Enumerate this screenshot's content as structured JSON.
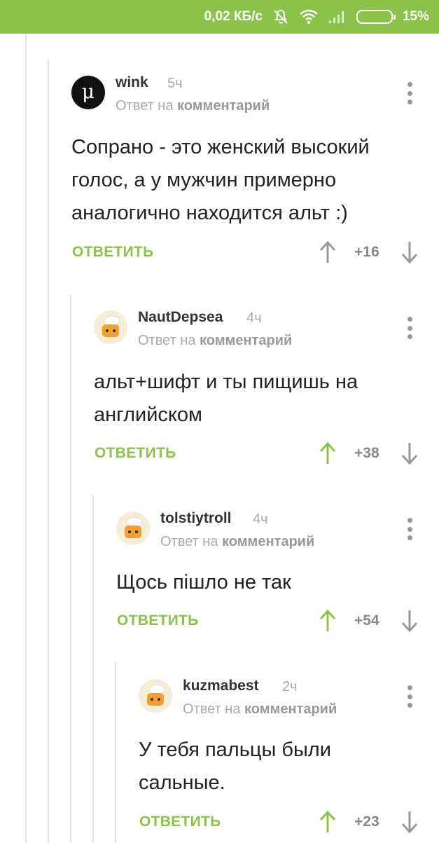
{
  "status_bar": {
    "speed": "0,02 КБ/с",
    "battery_percent": "15%",
    "battery_level": 0.15
  },
  "reply_to_prefix": "Ответ на",
  "reply_to_link": "комментарий",
  "reply_label": "ОТВЕТИТЬ",
  "colors": {
    "accent": "#8bc34a",
    "upvoted": "#8bc34a",
    "neutral": "#999999"
  },
  "comments": [
    {
      "username": "wink",
      "time": "5ч",
      "text_lines": [
        "Сопрано - это женский высокий",
        "голос, а у мужчин примерно",
        "аналогично находится альт :)"
      ],
      "score": "+16",
      "upvoted": false
    },
    {
      "username": "NautDepsea",
      "time": "4ч",
      "text_lines": [
        "альт+шифт и ты пищишь на",
        "английском"
      ],
      "score": "+38",
      "upvoted": true
    },
    {
      "username": "tolstiytroll",
      "time": "4ч",
      "text_lines": [
        "Щось пішло не так"
      ],
      "score": "+54",
      "upvoted": true
    },
    {
      "username": "kuzmabest",
      "time": "2ч",
      "text_lines": [
        "У тебя пальцы были",
        "сальные."
      ],
      "score": "+23",
      "upvoted": true
    }
  ]
}
